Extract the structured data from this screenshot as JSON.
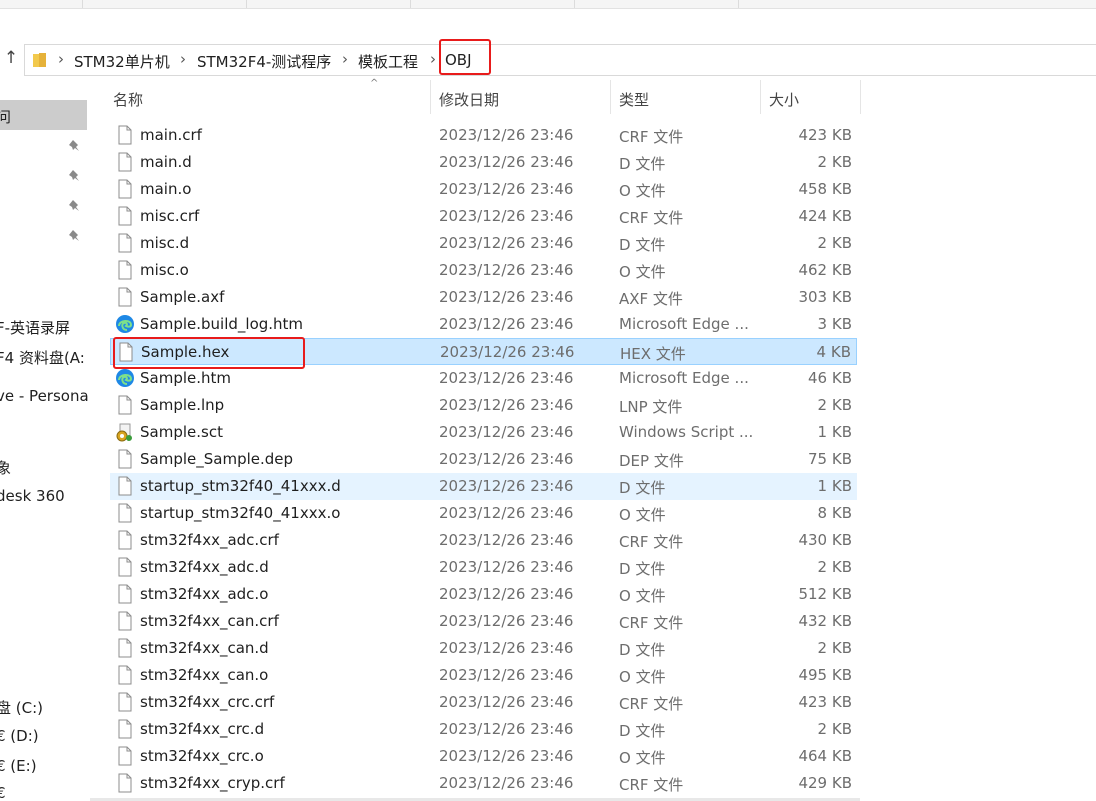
{
  "breadcrumb": [
    {
      "label": "STM32单片机"
    },
    {
      "label": "STM32F4-测试程序"
    },
    {
      "label": "模板工程"
    },
    {
      "label": "OBJ"
    }
  ],
  "sidebar": {
    "items": [
      {
        "label": "问"
      },
      {
        "label": "F-英语录屏"
      },
      {
        "label": "F4 资料盘(A:"
      },
      {
        "label": "ve - Persona"
      },
      {
        "label": "象"
      },
      {
        "label": "desk 360"
      },
      {
        "label": "盘 (C:)"
      },
      {
        "label": "€ (D:)"
      },
      {
        "label": "€ (E:)"
      },
      {
        "label": "€"
      }
    ]
  },
  "columns": {
    "name": "名称",
    "date": "修改日期",
    "type": "类型",
    "size": "大小"
  },
  "files": [
    {
      "name": "main.crf",
      "date": "2023/12/26 23:46",
      "type": "CRF 文件",
      "size": "423 KB",
      "icon": "file-icon"
    },
    {
      "name": "main.d",
      "date": "2023/12/26 23:46",
      "type": "D 文件",
      "size": "2 KB",
      "icon": "file-icon"
    },
    {
      "name": "main.o",
      "date": "2023/12/26 23:46",
      "type": "O 文件",
      "size": "458 KB",
      "icon": "file-icon"
    },
    {
      "name": "misc.crf",
      "date": "2023/12/26 23:46",
      "type": "CRF 文件",
      "size": "424 KB",
      "icon": "file-icon"
    },
    {
      "name": "misc.d",
      "date": "2023/12/26 23:46",
      "type": "D 文件",
      "size": "2 KB",
      "icon": "file-icon"
    },
    {
      "name": "misc.o",
      "date": "2023/12/26 23:46",
      "type": "O 文件",
      "size": "462 KB",
      "icon": "file-icon"
    },
    {
      "name": "Sample.axf",
      "date": "2023/12/26 23:46",
      "type": "AXF 文件",
      "size": "303 KB",
      "icon": "file-icon"
    },
    {
      "name": "Sample.build_log.htm",
      "date": "2023/12/26 23:46",
      "type": "Microsoft Edge ...",
      "size": "3 KB",
      "icon": "edge-icon"
    },
    {
      "name": "Sample.hex",
      "date": "2023/12/26 23:46",
      "type": "HEX 文件",
      "size": "4 KB",
      "icon": "file-icon",
      "state": "selected"
    },
    {
      "name": "Sample.htm",
      "date": "2023/12/26 23:46",
      "type": "Microsoft Edge ...",
      "size": "46 KB",
      "icon": "edge-icon"
    },
    {
      "name": "Sample.lnp",
      "date": "2023/12/26 23:46",
      "type": "LNP 文件",
      "size": "2 KB",
      "icon": "file-icon"
    },
    {
      "name": "Sample.sct",
      "date": "2023/12/26 23:46",
      "type": "Windows Script ...",
      "size": "1 KB",
      "icon": "script-icon"
    },
    {
      "name": "Sample_Sample.dep",
      "date": "2023/12/26 23:46",
      "type": "DEP 文件",
      "size": "75 KB",
      "icon": "file-icon"
    },
    {
      "name": "startup_stm32f40_41xxx.d",
      "date": "2023/12/26 23:46",
      "type": "D 文件",
      "size": "1 KB",
      "icon": "file-icon",
      "state": "hover"
    },
    {
      "name": "startup_stm32f40_41xxx.o",
      "date": "2023/12/26 23:46",
      "type": "O 文件",
      "size": "8 KB",
      "icon": "file-icon"
    },
    {
      "name": "stm32f4xx_adc.crf",
      "date": "2023/12/26 23:46",
      "type": "CRF 文件",
      "size": "430 KB",
      "icon": "file-icon"
    },
    {
      "name": "stm32f4xx_adc.d",
      "date": "2023/12/26 23:46",
      "type": "D 文件",
      "size": "2 KB",
      "icon": "file-icon"
    },
    {
      "name": "stm32f4xx_adc.o",
      "date": "2023/12/26 23:46",
      "type": "O 文件",
      "size": "512 KB",
      "icon": "file-icon"
    },
    {
      "name": "stm32f4xx_can.crf",
      "date": "2023/12/26 23:46",
      "type": "CRF 文件",
      "size": "432 KB",
      "icon": "file-icon"
    },
    {
      "name": "stm32f4xx_can.d",
      "date": "2023/12/26 23:46",
      "type": "D 文件",
      "size": "2 KB",
      "icon": "file-icon"
    },
    {
      "name": "stm32f4xx_can.o",
      "date": "2023/12/26 23:46",
      "type": "O 文件",
      "size": "495 KB",
      "icon": "file-icon"
    },
    {
      "name": "stm32f4xx_crc.crf",
      "date": "2023/12/26 23:46",
      "type": "CRF 文件",
      "size": "423 KB",
      "icon": "file-icon"
    },
    {
      "name": "stm32f4xx_crc.d",
      "date": "2023/12/26 23:46",
      "type": "D 文件",
      "size": "2 KB",
      "icon": "file-icon"
    },
    {
      "name": "stm32f4xx_crc.o",
      "date": "2023/12/26 23:46",
      "type": "O 文件",
      "size": "464 KB",
      "icon": "file-icon"
    },
    {
      "name": "stm32f4xx_cryp.crf",
      "date": "2023/12/26 23:46",
      "type": "CRF 文件",
      "size": "429 KB",
      "icon": "file-icon"
    }
  ],
  "colors": {
    "highlight_box": "#e81b1b",
    "selected_row": "#cce8ff",
    "hover_row": "#e5f3ff",
    "folder": "#f2c94c",
    "edge": "#1e88e5"
  }
}
